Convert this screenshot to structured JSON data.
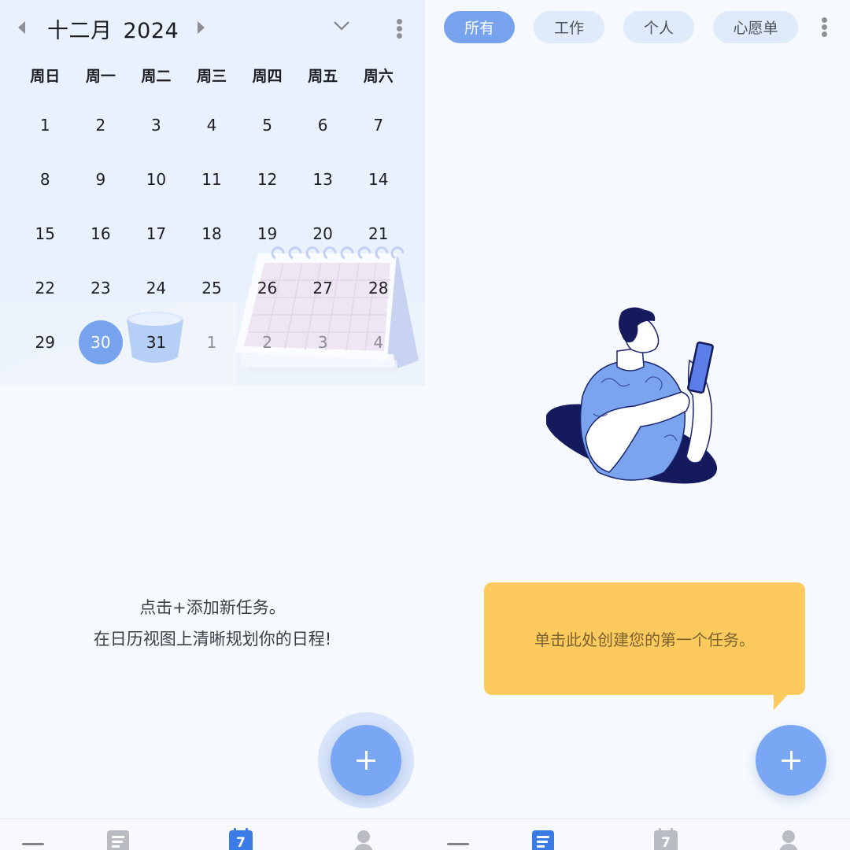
{
  "left_screen": {
    "calendar": {
      "month": "十二月",
      "year": "2024",
      "weekdays": [
        "周日",
        "周一",
        "周二",
        "周三",
        "周四",
        "周五",
        "周六"
      ],
      "days": [
        {
          "label": "1",
          "state": "current"
        },
        {
          "label": "2",
          "state": "current"
        },
        {
          "label": "3",
          "state": "current"
        },
        {
          "label": "4",
          "state": "current"
        },
        {
          "label": "5",
          "state": "current"
        },
        {
          "label": "6",
          "state": "current"
        },
        {
          "label": "7",
          "state": "current"
        },
        {
          "label": "8",
          "state": "current"
        },
        {
          "label": "9",
          "state": "current"
        },
        {
          "label": "10",
          "state": "current"
        },
        {
          "label": "11",
          "state": "current"
        },
        {
          "label": "12",
          "state": "current"
        },
        {
          "label": "13",
          "state": "current"
        },
        {
          "label": "14",
          "state": "current"
        },
        {
          "label": "15",
          "state": "current"
        },
        {
          "label": "16",
          "state": "current"
        },
        {
          "label": "17",
          "state": "current"
        },
        {
          "label": "18",
          "state": "current"
        },
        {
          "label": "19",
          "state": "current"
        },
        {
          "label": "20",
          "state": "current"
        },
        {
          "label": "21",
          "state": "current"
        },
        {
          "label": "22",
          "state": "current"
        },
        {
          "label": "23",
          "state": "current"
        },
        {
          "label": "24",
          "state": "current"
        },
        {
          "label": "25",
          "state": "current"
        },
        {
          "label": "26",
          "state": "current"
        },
        {
          "label": "27",
          "state": "current"
        },
        {
          "label": "28",
          "state": "current"
        },
        {
          "label": "29",
          "state": "current"
        },
        {
          "label": "30",
          "state": "selected"
        },
        {
          "label": "31",
          "state": "current"
        },
        {
          "label": "1",
          "state": "other"
        },
        {
          "label": "2",
          "state": "other"
        },
        {
          "label": "3",
          "state": "other"
        },
        {
          "label": "4",
          "state": "other"
        }
      ],
      "icons": {
        "prev": "caret-left-icon",
        "next": "caret-right-icon",
        "expand": "chevron-down-icon",
        "more": "more-vertical-icon"
      }
    },
    "empty_message": {
      "line1": "点击+添加新任务。",
      "line2": "在日历视图上清晰规划你的日程!"
    },
    "fab_icon": "plus-icon",
    "bottom_nav": {
      "items": [
        {
          "icon": "menu-dash-icon",
          "active": false
        },
        {
          "icon": "task-list-icon",
          "active": false
        },
        {
          "icon": "calendar-icon",
          "active": true,
          "badge": "7"
        },
        {
          "icon": "profile-icon",
          "active": false
        }
      ]
    }
  },
  "right_screen": {
    "filter_chips": [
      {
        "label": "所有",
        "active": true
      },
      {
        "label": "工作",
        "active": false
      },
      {
        "label": "个人",
        "active": false
      },
      {
        "label": "心愿单",
        "active": false
      }
    ],
    "more_icon": "more-vertical-icon",
    "tooltip": "单击此处创建您的第一个任务。",
    "fab_icon": "plus-icon",
    "bottom_nav": {
      "items": [
        {
          "icon": "menu-dash-icon",
          "active": false
        },
        {
          "icon": "task-list-icon",
          "active": true
        },
        {
          "icon": "calendar-icon",
          "active": false,
          "badge": "7"
        },
        {
          "icon": "profile-icon",
          "active": false
        }
      ]
    }
  },
  "colors": {
    "accent": "#77a3ee",
    "active_nav": "#3b7be8",
    "inactive_nav": "#b9bcc2",
    "tooltip_bg": "#fdca5e",
    "calendar_bg": "#e9f1fd",
    "page_bg": "#f6faff"
  }
}
